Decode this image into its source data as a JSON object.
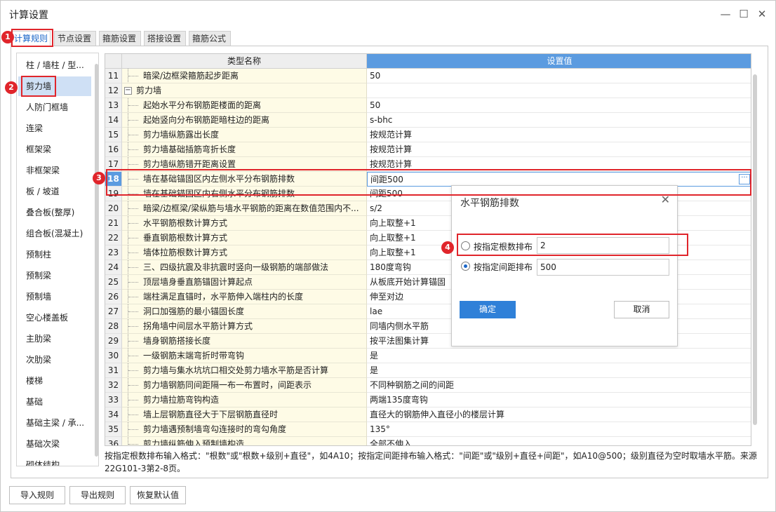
{
  "window": {
    "title": "计算设置",
    "minimize": "—",
    "maximize": "☐",
    "close": "✕"
  },
  "tabs": [
    "计算规则",
    "节点设置",
    "箍筋设置",
    "搭接设置",
    "箍筋公式"
  ],
  "left_items": [
    "柱 / 墙柱 / 型...",
    "剪力墙",
    "人防门框墙",
    "连梁",
    "框架梁",
    "非框架梁",
    "板 / 坡道",
    "叠合板(整厚)",
    "组合板(混凝土)",
    "预制柱",
    "预制梁",
    "预制墙",
    "空心楼盖板",
    "主肋梁",
    "次肋梁",
    "楼梯",
    "基础",
    "基础主梁 / 承...",
    "基础次梁",
    "砌体结构"
  ],
  "grid": {
    "col_name": "类型名称",
    "col_value": "设置值",
    "rows": [
      {
        "idx": "11",
        "name": "暗梁/边框梁箍筋起步距离",
        "value": "50"
      },
      {
        "idx": "12",
        "name": "剪力墙",
        "value": "",
        "group": true
      },
      {
        "idx": "13",
        "name": "起始水平分布钢筋距楼面的距离",
        "value": "50"
      },
      {
        "idx": "14",
        "name": "起始竖向分布钢筋距暗柱边的距离",
        "value": "s-bhc"
      },
      {
        "idx": "15",
        "name": "剪力墙纵筋露出长度",
        "value": "按规范计算"
      },
      {
        "idx": "16",
        "name": "剪力墙基础插筋弯折长度",
        "value": "按规范计算"
      },
      {
        "idx": "17",
        "name": "剪力墙纵筋错开距离设置",
        "value": "按规范计算"
      },
      {
        "idx": "18",
        "name": "墙在基础锚固区内左侧水平分布钢筋排数",
        "value": "间距500",
        "current": true
      },
      {
        "idx": "19",
        "name": "墙在基础锚固区内右侧水平分布钢筋排数",
        "value": "间距500"
      },
      {
        "idx": "20",
        "name": "暗梁/边框梁/梁纵筋与墙水平钢筋的距离在数值范围内不...",
        "value": "s/2"
      },
      {
        "idx": "21",
        "name": "水平钢筋根数计算方式",
        "value": "向上取整+1"
      },
      {
        "idx": "22",
        "name": "垂直钢筋根数计算方式",
        "value": "向上取整+1"
      },
      {
        "idx": "23",
        "name": "墙体拉筋根数计算方式",
        "value": "向上取整+1"
      },
      {
        "idx": "24",
        "name": "三、四级抗震及非抗震时竖向一级钢筋的端部做法",
        "value": "180度弯钩"
      },
      {
        "idx": "25",
        "name": "顶层墙身垂直筋锚固计算起点",
        "value": "从板底开始计算锚固"
      },
      {
        "idx": "26",
        "name": "端柱满足直锚时，水平筋伸入端柱内的长度",
        "value": "伸至对边"
      },
      {
        "idx": "27",
        "name": "洞口加强筋的最小锚固长度",
        "value": "lae"
      },
      {
        "idx": "28",
        "name": "拐角墙中间层水平筋计算方式",
        "value": "同墙内侧水平筋"
      },
      {
        "idx": "29",
        "name": "墙身钢筋搭接长度",
        "value": "按平法图集计算"
      },
      {
        "idx": "30",
        "name": "一级钢筋末端弯折时带弯钩",
        "value": "是"
      },
      {
        "idx": "31",
        "name": "剪力墙与集水坑坑口相交处剪力墙水平筋是否计算",
        "value": "是"
      },
      {
        "idx": "32",
        "name": "剪力墙钢筋同间距隔一布一布置时，间距表示",
        "value": "不同种钢筋之间的间距"
      },
      {
        "idx": "33",
        "name": "剪力墙拉筋弯钩构造",
        "value": "两端135度弯钩"
      },
      {
        "idx": "34",
        "name": "墙上层钢筋直径大于下层钢筋直径时",
        "value": "直径大的钢筋伸入直径小的楼层计算"
      },
      {
        "idx": "35",
        "name": "剪力墙遇预制墙弯勾连接时的弯勾角度",
        "value": "135°"
      },
      {
        "idx": "36",
        "name": "剪力墙纵筋伸入预制墙构造",
        "value": "全部不伸入"
      }
    ]
  },
  "hint": "按指定根数排布输入格式：\"根数\"或\"根数+级别+直径\"，如4A10；按指定间距排布输入格式：\"间距\"或\"级别+直径+间距\"，如A10@500；级别直径为空时取墙水平筋。来源22G101-3第2-8页。",
  "buttons": {
    "import": "导入规则",
    "export": "导出规则",
    "restore": "恢复默认值"
  },
  "dialog": {
    "title": "水平钢筋排数",
    "close": "✕",
    "option1_label": "按指定根数排布",
    "option1_value": "2",
    "option2_label": "按指定间距排布",
    "option2_value": "500",
    "ok": "确定",
    "cancel": "取消"
  },
  "markers": [
    "1",
    "2",
    "3",
    "4"
  ],
  "colors": {
    "accent": "#5b9be0",
    "primary_button": "#2f80d8",
    "annotation": "#e0252b",
    "name_cell_bg": "#fefbe6"
  }
}
